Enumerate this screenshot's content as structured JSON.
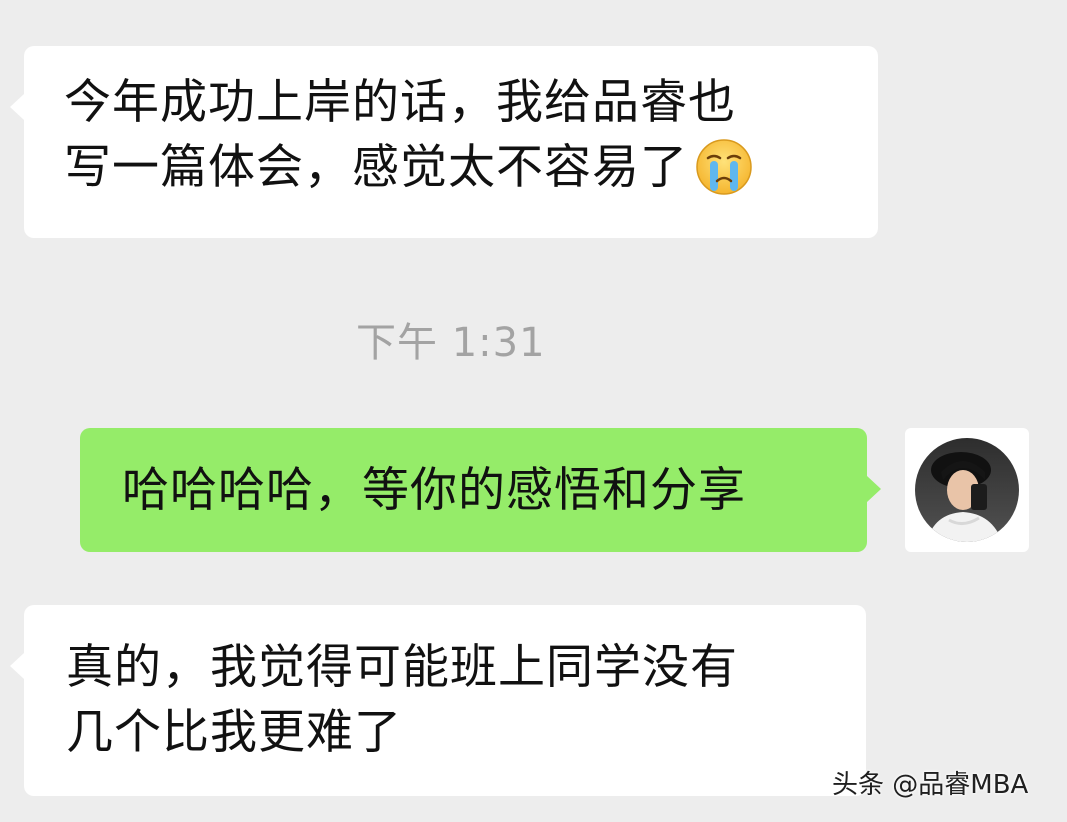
{
  "messages": [
    {
      "direction": "incoming",
      "lines": [
        "今年成功上岸的话，我给品睿也",
        "写一篇体会，感觉太不容易了"
      ],
      "emoji": "crying-face-icon"
    },
    {
      "direction": "outgoing",
      "lines": [
        "哈哈哈哈，等你的感悟和分享"
      ]
    },
    {
      "direction": "incoming",
      "lines": [
        "真的，我觉得可能班上同学没有",
        "几个比我更难了"
      ]
    }
  ],
  "timestamp": "下午 1:31",
  "avatar": {
    "icon": "user-avatar-photo"
  },
  "watermark": "头条 @品睿MBA",
  "colors": {
    "background": "#ededed",
    "incoming_bubble": "#ffffff",
    "outgoing_bubble": "#95ec69",
    "timestamp_text": "#a3a3a3"
  }
}
